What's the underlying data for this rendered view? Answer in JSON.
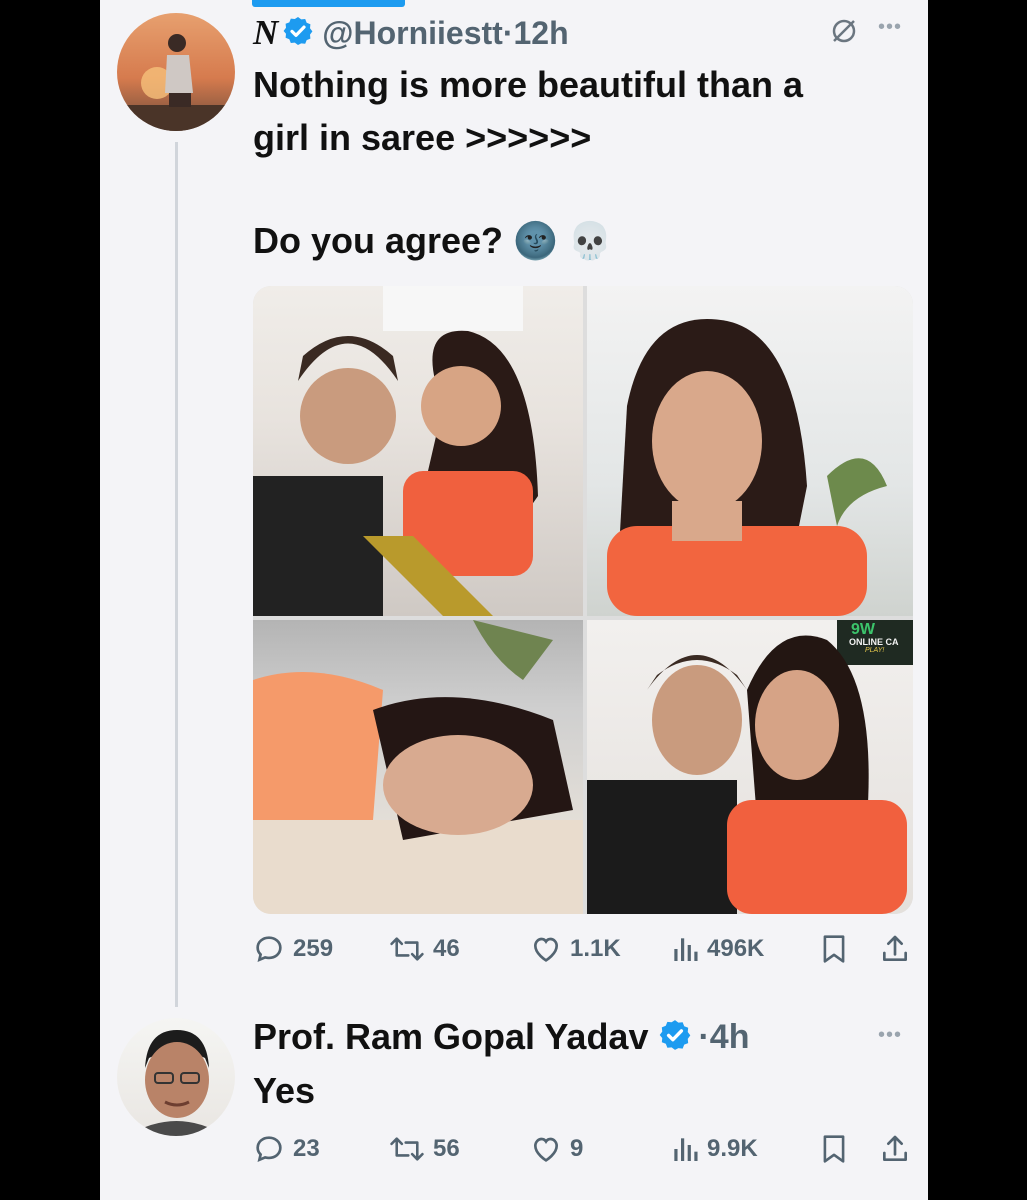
{
  "tweet": {
    "display_name": "N",
    "handle": "@Horniiestt",
    "time": "·12h",
    "text_line1": "Nothing is more beautiful than a",
    "text_line2": "girl in saree >>>>>>",
    "text_line3": "Do you agree? 🌚 💀",
    "emoji_moon": "🌚",
    "emoji_skull": "💀",
    "media_overlay_text_1": "9W",
    "media_overlay_text_2": "ONLINE CA",
    "media_overlay_text_3": "PLAY!",
    "stats": {
      "replies": "259",
      "reposts": "46",
      "likes": "1.1K",
      "views": "496K"
    }
  },
  "reply": {
    "display_name": "Prof. Ram Gopal Yadav",
    "time": "·4h",
    "text": "Yes",
    "stats": {
      "replies": "23",
      "reposts": "56",
      "likes": "9",
      "views": "9.9K"
    }
  },
  "colors": {
    "accent": "#1d9bf0",
    "background": "#f4f4f7",
    "text": "#111111",
    "muted": "#536471"
  }
}
